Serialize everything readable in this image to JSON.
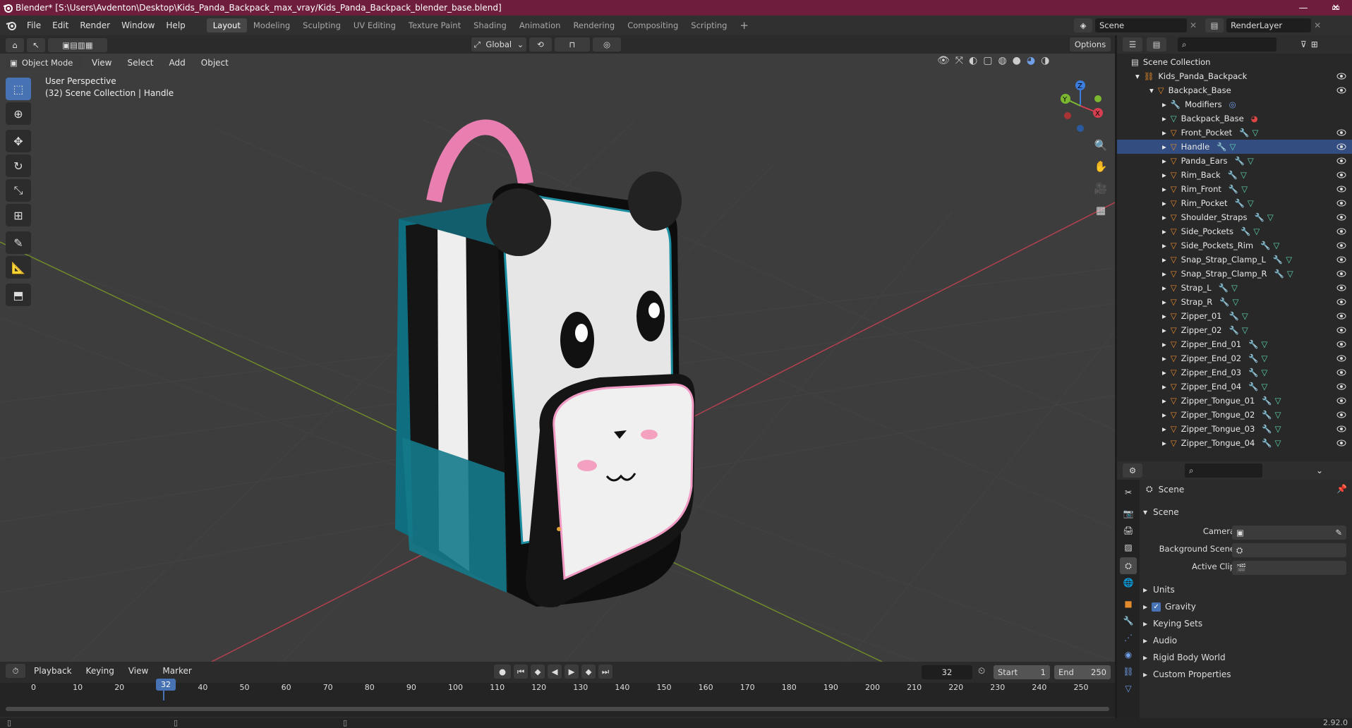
{
  "window": {
    "title": "Blender* [S:\\Users\\Avdenton\\Desktop\\Kids_Panda_Backpack_max_vray/Kids_Panda_Backpack_blender_base.blend]",
    "controls": [
      "—",
      "▭",
      "✕"
    ]
  },
  "menu": [
    "File",
    "Edit",
    "Render",
    "Window",
    "Help"
  ],
  "workspaces": [
    "Layout",
    "Modeling",
    "Sculpting",
    "UV Editing",
    "Texture Paint",
    "Shading",
    "Animation",
    "Rendering",
    "Compositing",
    "Scripting"
  ],
  "scene_field": "Scene",
  "renderlayer_field": "RenderLayer",
  "viewport": {
    "transform_orientation": "Global",
    "options_label": "Options",
    "mode": "Object Mode",
    "header_menus": [
      "View",
      "Select",
      "Add",
      "Object"
    ],
    "overlay_line1": "User Perspective",
    "overlay_line2": "(32) Scene Collection | Handle",
    "gizmo_axes": [
      "X",
      "Y",
      "Z"
    ]
  },
  "outliner": {
    "root": "Scene Collection",
    "collection": "Kids_Panda_Backpack",
    "parent": "Backpack_Base",
    "children": [
      "Modifiers",
      "Backpack_Base",
      "Front_Pocket",
      "Handle",
      "Panda_Ears",
      "Rim_Back",
      "Rim_Front",
      "Rim_Pocket",
      "Shoulder_Straps",
      "Side_Pockets",
      "Side_Pockets_Rim",
      "Snap_Strap_Clamp_L",
      "Snap_Strap_Clamp_R",
      "Strap_L",
      "Strap_R",
      "Zipper_01",
      "Zipper_02",
      "Zipper_End_01",
      "Zipper_End_02",
      "Zipper_End_03",
      "Zipper_End_04",
      "Zipper_Tongue_01",
      "Zipper_Tongue_02",
      "Zipper_Tongue_03",
      "Zipper_Tongue_04"
    ]
  },
  "properties": {
    "context": "Scene",
    "panel": "Scene",
    "camera_label": "Camera",
    "background_scene_label": "Background Scene",
    "active_clip_label": "Active Clip",
    "sections": [
      "Units",
      "Gravity",
      "Keying Sets",
      "Audio",
      "Rigid Body World",
      "Custom Properties"
    ],
    "gravity_checked": true
  },
  "timeline": {
    "menus": [
      "Playback",
      "Keying",
      "View",
      "Marker"
    ],
    "current_frame": "32",
    "start_label": "Start",
    "start": "1",
    "end_label": "End",
    "end": "250",
    "ticks": [
      "0",
      "10",
      "20",
      "30",
      "40",
      "50",
      "60",
      "70",
      "80",
      "90",
      "100",
      "110",
      "120",
      "130",
      "140",
      "150",
      "160",
      "170",
      "180",
      "190",
      "200",
      "210",
      "220",
      "230",
      "240",
      "250"
    ]
  },
  "status": {
    "version": "2.92.0"
  },
  "colors": {
    "title_bar": "#6e1d3d",
    "accent": "#4772b3",
    "x_axis": "#d63f50",
    "y_axis": "#7bb82f",
    "z_axis": "#3b7ee0"
  }
}
